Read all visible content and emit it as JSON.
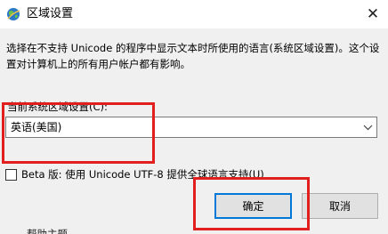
{
  "window": {
    "title": "区域设置",
    "close_glyph": "✕"
  },
  "description": "选择在不支持 Unicode 的程序中显示文本时所使用的语言(系统区域设置)。这个设置对计算机上的所有用户帐户都有影响。",
  "locale": {
    "label": "当前系统区域设置(C):",
    "selected": "英语(美国)"
  },
  "beta": {
    "label": "Beta 版: 使用 Unicode UTF-8 提供全球语言支持(U)",
    "checked": false
  },
  "buttons": {
    "ok_label": "确定",
    "cancel_label": "取消"
  },
  "clipped_text": "帮助主题",
  "colors": {
    "highlight": "#e21f1f",
    "focus_border": "#0078d7",
    "titlebar_bg": "#ffffff",
    "dialog_bg": "#f0f0f0"
  }
}
